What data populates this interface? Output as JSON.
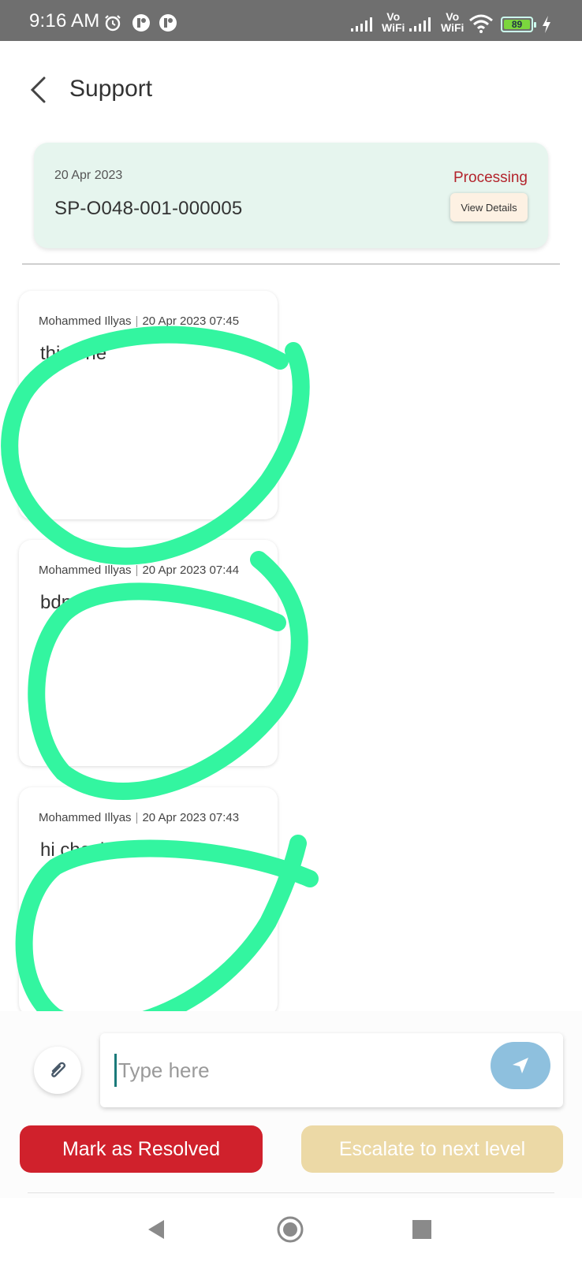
{
  "status_bar": {
    "time": "9:16 AM",
    "battery": "89",
    "vo_top": "Vo",
    "vo_bottom": "WiFi"
  },
  "header": {
    "title": "Support"
  },
  "ticket": {
    "date": "20 Apr 2023",
    "id": "SP-O048-001-000005",
    "status": "Processing",
    "view_details_label": "View Details",
    "colors": {
      "card_bg": "#e6f5ee",
      "status": "#b3242c"
    }
  },
  "messages": [
    {
      "author": "Mohammed Illyas",
      "timestamp": "20 Apr 2023 07:45",
      "text": "this one"
    },
    {
      "author": "Mohammed Illyas",
      "timestamp": "20 Apr 2023 07:44",
      "text": "bdn"
    },
    {
      "author": "Mohammed Illyas",
      "timestamp": "20 Apr 2023 07:43",
      "text": "hi check"
    }
  ],
  "composer": {
    "placeholder": "Type here"
  },
  "actions": {
    "resolve_label": "Mark as Resolved",
    "escalate_label": "Escalate to next level",
    "colors": {
      "resolve": "#d0212c",
      "escalate": "#ecd9a6"
    }
  },
  "annotation": {
    "color": "#33f5a0"
  }
}
